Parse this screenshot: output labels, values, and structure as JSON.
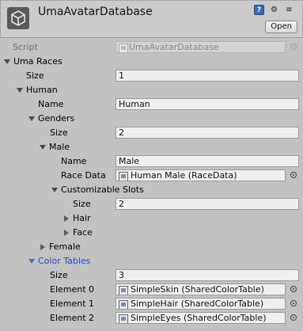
{
  "header": {
    "title": "UmaAvatarDatabase",
    "open_label": "Open",
    "help_glyph": "?",
    "settings_glyph": "⚙",
    "menu_glyph": "≡"
  },
  "script_row": {
    "label": "Script",
    "value": "UmaAvatarDatabase"
  },
  "uma_races": {
    "label": "Uma Races",
    "size_label": "Size",
    "size_value": "1",
    "human": {
      "label": "Human",
      "name_label": "Name",
      "name_value": "Human",
      "genders": {
        "label": "Genders",
        "size_label": "Size",
        "size_value": "2",
        "male": {
          "label": "Male",
          "name_label": "Name",
          "name_value": "Male",
          "race_data_label": "Race Data",
          "race_data_value": "Human Male (RaceData)",
          "customizable_slots": {
            "label": "Customizable Slots",
            "size_label": "Size",
            "size_value": "2",
            "items": [
              "Hair",
              "Face"
            ]
          }
        },
        "female_label": "Female"
      },
      "color_tables": {
        "label": "Color Tables",
        "size_label": "Size",
        "size_value": "3",
        "elements": [
          {
            "label": "Element 0",
            "value": "SimpleSkin (SharedColorTable)"
          },
          {
            "label": "Element 1",
            "value": "SimpleHair (SharedColorTable)"
          },
          {
            "label": "Element 2",
            "value": "SimpleEyes (SharedColorTable)"
          }
        ]
      }
    }
  },
  "colors": {
    "background": "#c2c2c2",
    "field_bg": "#efefef",
    "selected_label": "#1f4fd0",
    "help_icon": "#3c6fb6"
  }
}
